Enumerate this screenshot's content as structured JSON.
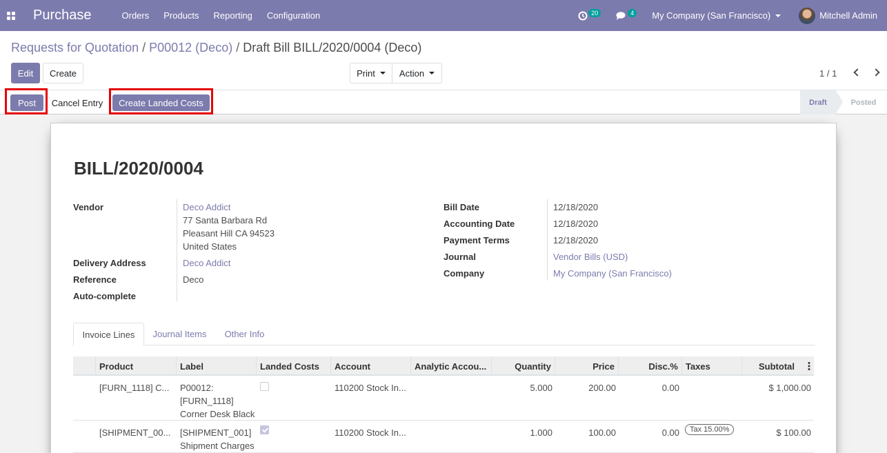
{
  "navbar": {
    "app_title": "Purchase",
    "menu": [
      "Orders",
      "Products",
      "Reporting",
      "Configuration"
    ],
    "activity_count": "20",
    "message_count": "4",
    "company": "My Company (San Francisco)",
    "user": "Mitchell Admin"
  },
  "breadcrumb": {
    "items": [
      "Requests for Quotation",
      "P00012 (Deco)",
      "Draft Bill BILL/2020/0004 (Deco)"
    ],
    "separator": "/"
  },
  "toolbar": {
    "edit_label": "Edit",
    "create_label": "Create",
    "print_label": "Print",
    "action_label": "Action",
    "pager": "1 / 1"
  },
  "statusbar": {
    "post_label": "Post",
    "cancel_label": "Cancel Entry",
    "landed_label": "Create Landed Costs",
    "stages": [
      "Draft",
      "Posted"
    ],
    "active_stage": "Draft"
  },
  "bill": {
    "title": "BILL/2020/0004",
    "left_fields": {
      "vendor_label": "Vendor",
      "vendor_name": "Deco Addict",
      "vendor_address": [
        "77 Santa Barbara Rd",
        "Pleasant Hill CA 94523",
        "United States"
      ],
      "delivery_label": "Delivery Address",
      "delivery_value": "Deco Addict",
      "reference_label": "Reference",
      "reference_value": "Deco",
      "autocomplete_label": "Auto-complete"
    },
    "right_fields": {
      "bill_date_label": "Bill Date",
      "bill_date_value": "12/18/2020",
      "accounting_date_label": "Accounting Date",
      "accounting_date_value": "12/18/2020",
      "payment_terms_label": "Payment Terms",
      "payment_terms_value": "12/18/2020",
      "journal_label": "Journal",
      "journal_value": "Vendor Bills (USD)",
      "company_label": "Company",
      "company_value": "My Company (San Francisco)"
    }
  },
  "tabs": [
    "Invoice Lines",
    "Journal Items",
    "Other Info"
  ],
  "lines": {
    "columns": [
      "Product",
      "Label",
      "Landed Costs",
      "Account",
      "Analytic Accou...",
      "Quantity",
      "Price",
      "Disc.%",
      "Taxes",
      "Subtotal"
    ],
    "rows": [
      {
        "product": "[FURN_1118] C...",
        "label": [
          "P00012:",
          "[FURN_1118]",
          "Corner Desk Black"
        ],
        "landed": false,
        "account": "110200 Stock In...",
        "analytic": "",
        "quantity": "5.000",
        "price": "200.00",
        "disc": "0.00",
        "taxes": "",
        "subtotal": "$ 1,000.00"
      },
      {
        "product": "[SHIPMENT_00...",
        "label": [
          "[SHIPMENT_001]",
          "Shipment Charges"
        ],
        "landed": true,
        "account": "110200 Stock In...",
        "analytic": "",
        "quantity": "1.000",
        "price": "100.00",
        "disc": "0.00",
        "taxes": "Tax 15.00%",
        "subtotal": "$ 100.00"
      }
    ]
  },
  "colors": {
    "brand": "#7c7bad",
    "highlight_box": "#e50000",
    "badge": "#00a09d"
  }
}
